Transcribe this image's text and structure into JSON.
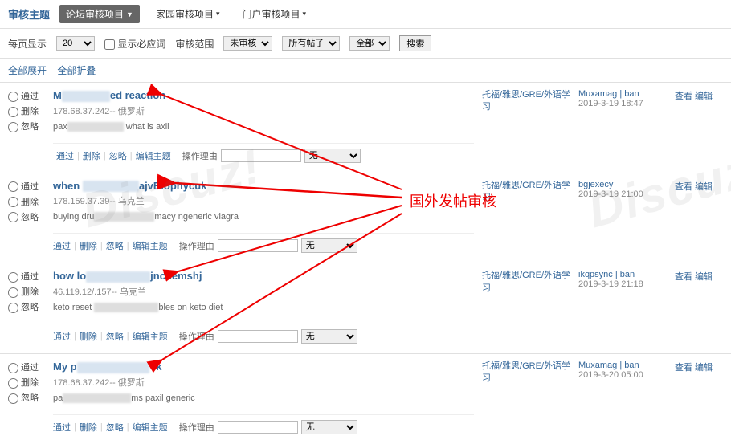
{
  "header": {
    "title": "审核主题",
    "tabs": [
      {
        "label": "论坛审核项目",
        "active": true
      },
      {
        "label": "家园审核项目",
        "active": false
      },
      {
        "label": "门户审核项目",
        "active": false
      }
    ]
  },
  "filter": {
    "perpage_label": "每页显示",
    "perpage_value": "20",
    "show_review_label": "显示必应词",
    "scope_label": "审核范围",
    "scope_value": "未审核",
    "poster_value": "所有帖子",
    "type_value": "全部",
    "search_btn": "搜索"
  },
  "expand": {
    "expand_all": "全部展开",
    "collapse_all": "全部折叠"
  },
  "row_actions": {
    "pass": "通过",
    "delete": "删除",
    "ignore": "忽略"
  },
  "action_line": {
    "pass": "通过",
    "delete": "删除",
    "ignore": "忽略",
    "edit_topic": "编辑主题",
    "reason_label": "操作理由",
    "none_option": "无"
  },
  "view": {
    "view": "查看",
    "edit": "编辑"
  },
  "posts": [
    {
      "title_pre": "M",
      "title_post": "ed reaction",
      "ip": "178.68.37.242-- 俄罗斯",
      "snippet_pre": "<a >pax",
      "snippet_post": " what is    axil",
      "category": "托福/雅思/GRE/外语学习",
      "user": "Muxamag | ban",
      "date": "2019-3-19 18:47"
    },
    {
      "title_pre": "when ",
      "title_post": "ajvBlophycuk",
      "ip": "178.159.37.39-- 乌克兰",
      "snippet_pre": "buying dru",
      "snippet_post": "macy <a >ngeneric viagra</a>",
      "category": "托福/雅思/GRE/外语学习",
      "user": "bgjexecy",
      "date": "2019-3-19 21:00"
    },
    {
      "title_pre": "how lo",
      "title_post": "jnchemshj",
      "ip": "46.119.12/.157-- 乌克兰",
      "snippet_pre": "keto reset ",
      "snippet_post": "bles on keto diet </a>",
      "category": "托福/雅思/GRE/外语学习",
      "user": "ikqpsync | ban",
      "date": "2019-3-19 21:18"
    },
    {
      "title_pre": "My p",
      "title_post": "   rk",
      "ip": "178.68.37.242-- 俄罗斯",
      "snippet_pre": "<a >pa",
      "snippet_post": "ms </a>  paxil generic",
      "category": "托福/雅思/GRE/外语学习",
      "user": "Muxamag | ban",
      "date": "2019-3-20 05:00"
    }
  ],
  "annotation": "国外发帖审核",
  "watermark": "Discuz!"
}
